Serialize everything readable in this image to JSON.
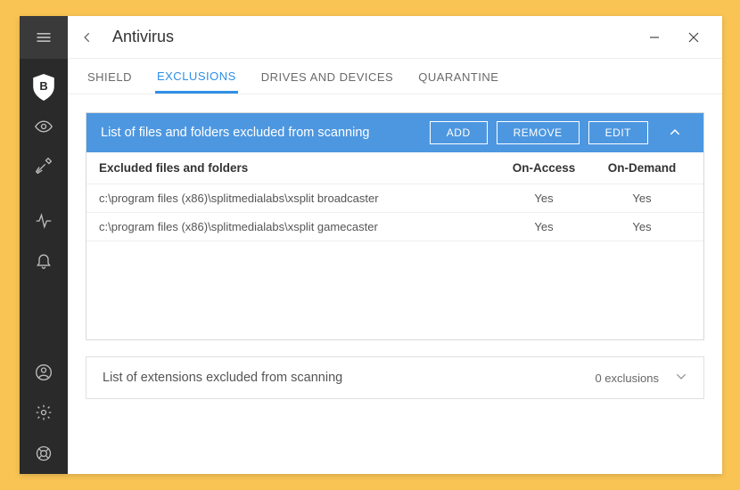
{
  "window": {
    "title": "Antivirus"
  },
  "tabs": {
    "shield": "SHIELD",
    "exclusions": "EXCLUSIONS",
    "drives": "DRIVES AND DEVICES",
    "quarantine": "QUARANTINE"
  },
  "files_panel": {
    "title": "List of files and folders excluded from scanning",
    "add": "ADD",
    "remove": "REMOVE",
    "edit": "EDIT",
    "header": {
      "path": "Excluded files and folders",
      "on_access": "On-Access",
      "on_demand": "On-Demand"
    },
    "rows": [
      {
        "path": "c:\\program files (x86)\\splitmedialabs\\xsplit broadcaster",
        "on_access": "Yes",
        "on_demand": "Yes"
      },
      {
        "path": "c:\\program files (x86)\\splitmedialabs\\xsplit gamecaster",
        "on_access": "Yes",
        "on_demand": "Yes"
      }
    ]
  },
  "ext_panel": {
    "title": "List of extensions excluded from scanning",
    "count": "0 exclusions"
  }
}
